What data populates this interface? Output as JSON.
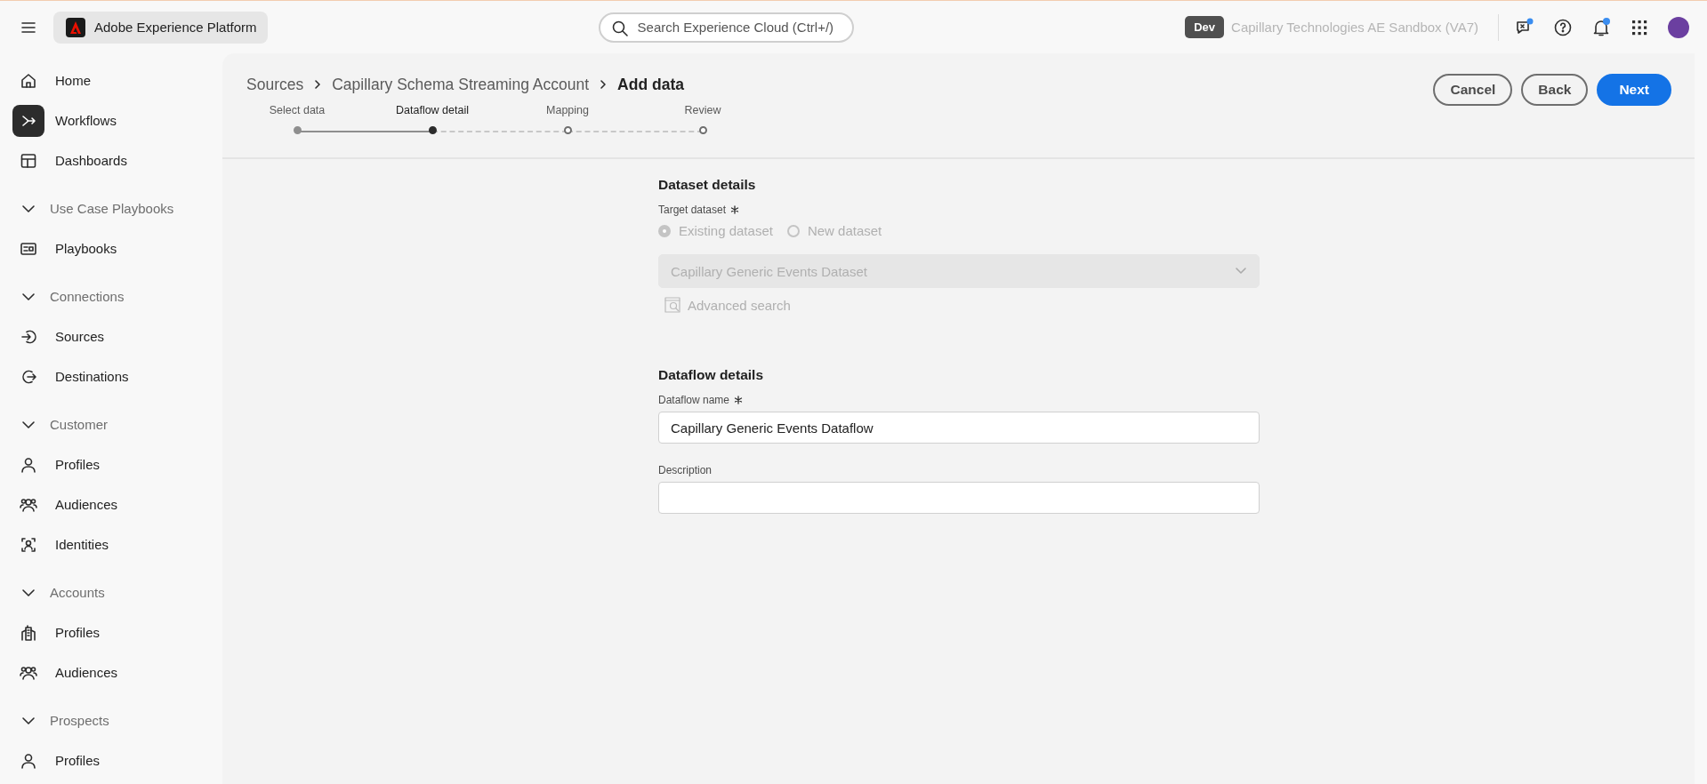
{
  "header": {
    "app_name": "Adobe Experience Platform",
    "search": {
      "placeholder": "Search Experience Cloud (Ctrl+/)"
    },
    "environment_badge": "Dev",
    "sandbox_name": "Capillary Technologies AE Sandbox (VA7)"
  },
  "sidebar": {
    "items": [
      {
        "label": "Home",
        "selected": false
      },
      {
        "label": "Workflows",
        "selected": true
      },
      {
        "label": "Dashboards",
        "selected": false
      }
    ],
    "sections": [
      {
        "title": "Use Case Playbooks",
        "expanded": true,
        "items": [
          {
            "label": "Playbooks",
            "selected": false
          }
        ]
      },
      {
        "title": "Connections",
        "expanded": true,
        "items": [
          {
            "label": "Sources",
            "selected": false
          },
          {
            "label": "Destinations",
            "selected": false
          }
        ]
      },
      {
        "title": "Customer",
        "expanded": true,
        "items": [
          {
            "label": "Profiles",
            "selected": false
          },
          {
            "label": "Audiences",
            "selected": false
          },
          {
            "label": "Identities",
            "selected": false
          }
        ]
      },
      {
        "title": "Accounts",
        "expanded": true,
        "items": [
          {
            "label": "Profiles",
            "selected": false
          },
          {
            "label": "Audiences",
            "selected": false
          }
        ]
      },
      {
        "title": "Prospects",
        "expanded": true,
        "items": [
          {
            "label": "Profiles",
            "selected": false
          }
        ]
      }
    ]
  },
  "breadcrumb": [
    "Sources",
    "Capillary Schema Streaming Account",
    "Add data"
  ],
  "actions": [
    {
      "label": "Cancel",
      "kind": "secondary"
    },
    {
      "label": "Back",
      "kind": "secondary"
    },
    {
      "label": "Next",
      "kind": "primary"
    }
  ],
  "steps": [
    {
      "label": "Select data",
      "completed": true,
      "selected": false
    },
    {
      "label": "Dataflow detail",
      "completed": false,
      "selected": true
    },
    {
      "label": "Mapping",
      "completed": false,
      "selected": false
    },
    {
      "label": "Review",
      "completed": false,
      "selected": false
    }
  ],
  "dataset_details": {
    "title": "Dataset details",
    "target_label": "Target dataset",
    "required": true,
    "options": [
      {
        "label": "Existing dataset",
        "selected": true,
        "disabled": true
      },
      {
        "label": "New dataset",
        "selected": false,
        "disabled": true
      }
    ],
    "dataset_select": {
      "value": "Capillary Generic Events Dataset",
      "disabled": true
    },
    "advanced_search": {
      "label": "Advanced search",
      "disabled": true
    }
  },
  "dataflow_details": {
    "title": "Dataflow details",
    "fields": [
      {
        "label": "Dataflow name",
        "required": true,
        "value": "Capillary Generic Events Dataflow"
      },
      {
        "label": "Description",
        "required": false
      }
    ]
  }
}
